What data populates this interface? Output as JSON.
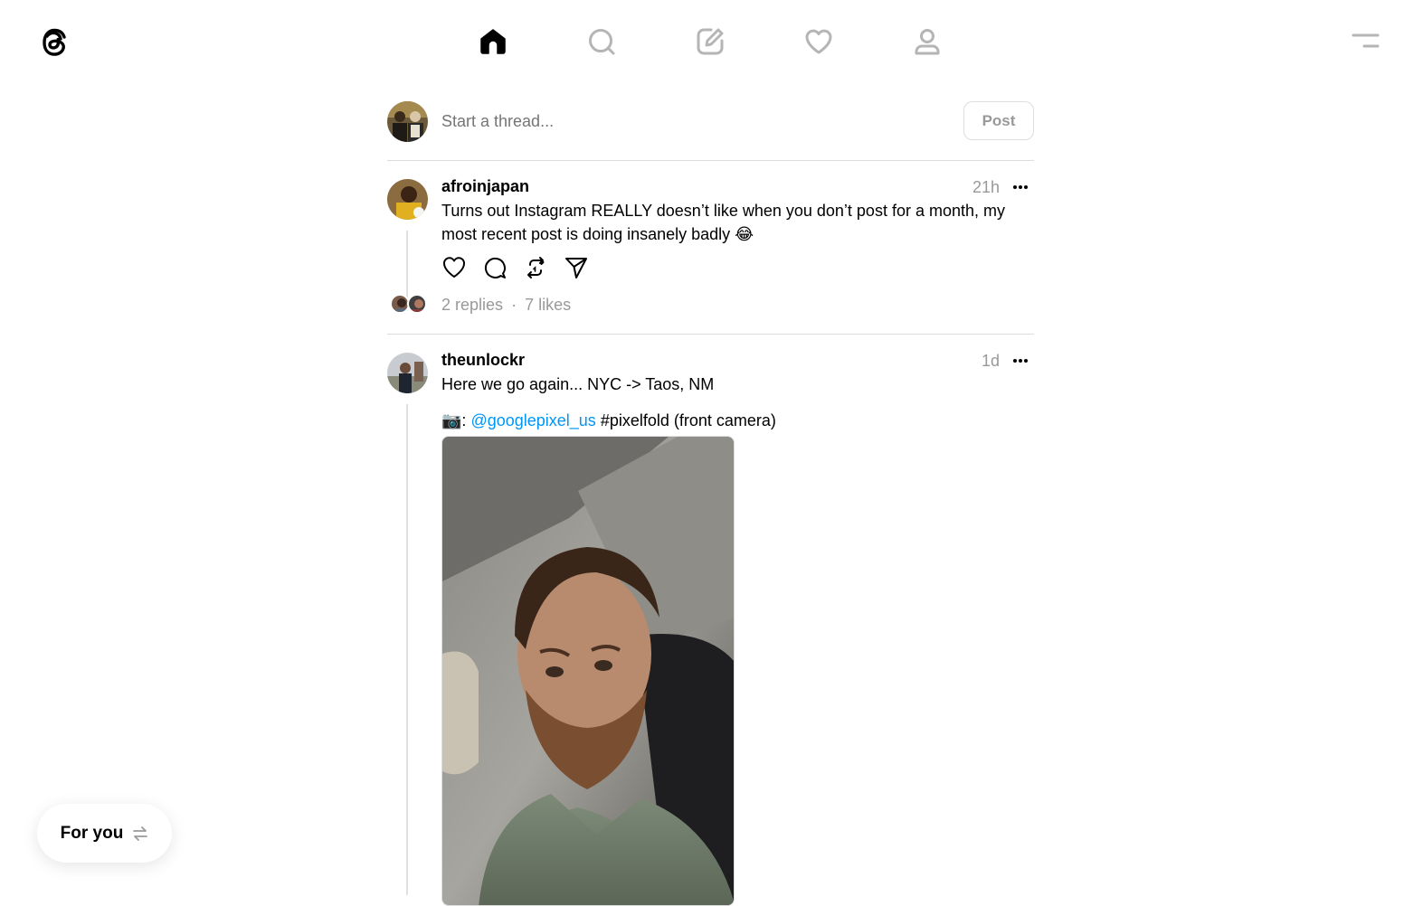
{
  "nav": {
    "items": [
      "home",
      "search",
      "create",
      "activity",
      "profile"
    ],
    "active": "home"
  },
  "composer": {
    "placeholder": "Start a thread...",
    "post_label": "Post"
  },
  "posts": [
    {
      "username": "afroinjapan",
      "time": "21h",
      "text": "Turns out Instagram REALLY doesn’t like when you don’t post for a month, my most recent post is doing insanely badly 😂",
      "replies": "2 replies",
      "separator": "·",
      "likes": "7 likes"
    },
    {
      "username": "theunlockr",
      "time": "1d",
      "text": "Here we go again... NYC -> Taos, NM",
      "caption_emoji": "📷:",
      "mention": "@googlepixel_us",
      "caption_rest": "#pixelfold (front camera)"
    }
  ],
  "feed_switch": {
    "label": "For you",
    "icon": "swap-arrows-icon"
  },
  "colors": {
    "link": "#0095f6",
    "muted": "#999999",
    "divider": "#dcdcdc"
  }
}
